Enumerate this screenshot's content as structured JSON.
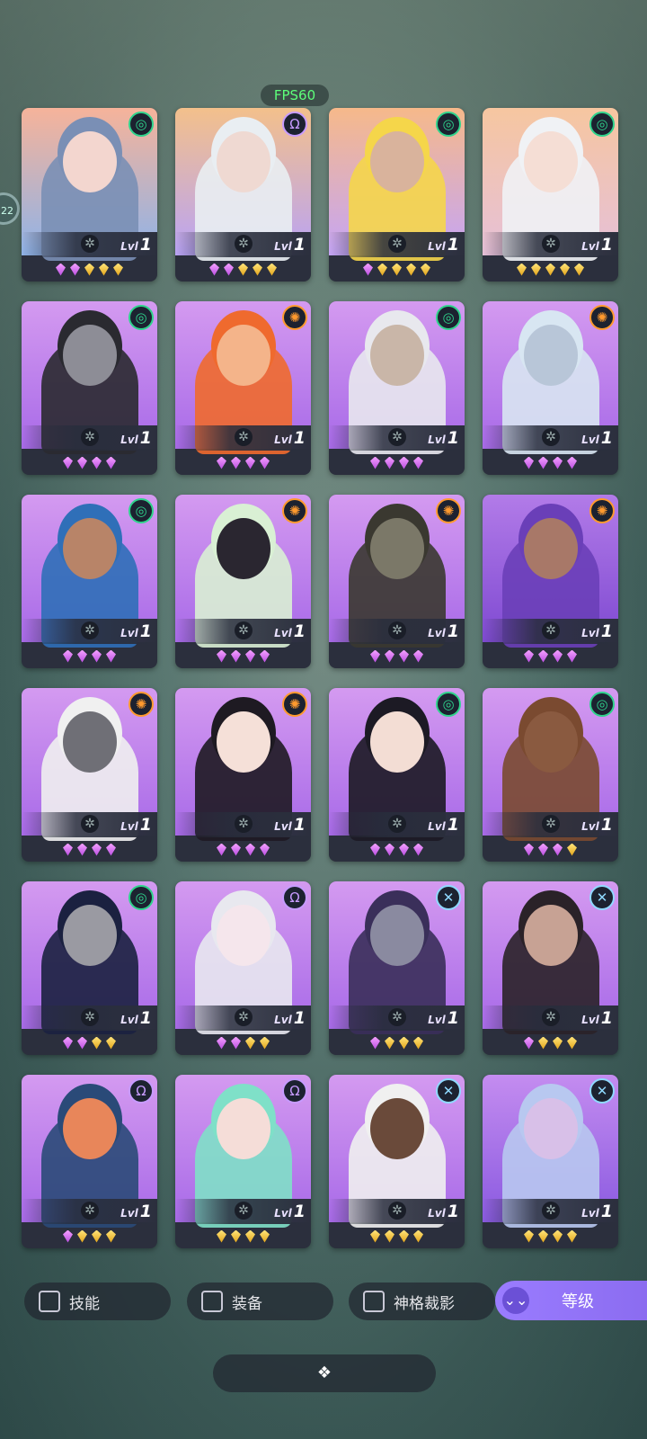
{
  "overlay": {
    "fps": "FPS60",
    "side_badge": "22"
  },
  "class_icons": {
    "swirl": {
      "glyph": "◎",
      "color": "#2fd38c"
    },
    "helm": {
      "glyph": "Ω",
      "color": "#c79bff"
    },
    "sun": {
      "glyph": "✺",
      "color": "#ff9a2e"
    },
    "cross": {
      "glyph": "✕",
      "color": "#8fd9ff"
    }
  },
  "lvl_prefix": "Lvl",
  "heroes": [
    {
      "level": "1",
      "cls": "swirl",
      "bg": [
        "#f6b39a",
        "#8fb3e8"
      ],
      "hair": "#7a8fb5",
      "skin": "#f3d6cf",
      "gems": "ppggg"
    },
    {
      "level": "1",
      "cls": "helm",
      "bg": [
        "#f3c08b",
        "#b9a3f5"
      ],
      "hair": "#e9eef2",
      "skin": "#efd9d2",
      "gems": "ppggg"
    },
    {
      "level": "1",
      "cls": "swirl",
      "bg": [
        "#f6b98a",
        "#c5a5f6"
      ],
      "hair": "#f5d64a",
      "skin": "#d9b39c",
      "gems": "pgggg"
    },
    {
      "level": "1",
      "cls": "swirl",
      "bg": [
        "#f6c6a0",
        "#e6c0d8"
      ],
      "hair": "#f0f2f5",
      "skin": "#f5ded5",
      "gems": "ggggg"
    },
    {
      "level": "1",
      "cls": "swirl",
      "bg": [
        "#d49af0",
        "#a86ae8"
      ],
      "hair": "#2a2a30",
      "skin": "#8d8d96",
      "gems": "pppp"
    },
    {
      "level": "1",
      "cls": "sun",
      "bg": [
        "#d49af0",
        "#a86ae8"
      ],
      "hair": "#ef6a2e",
      "skin": "#f4b48a",
      "gems": "pppp"
    },
    {
      "level": "1",
      "cls": "swirl",
      "bg": [
        "#d49af0",
        "#a86ae8"
      ],
      "hair": "#e8e8ee",
      "skin": "#c9b6a8",
      "gems": "pppp"
    },
    {
      "level": "1",
      "cls": "sun",
      "bg": [
        "#d49af0",
        "#a86ae8"
      ],
      "hair": "#d8e6f2",
      "skin": "#b8c6d8",
      "gems": "pppp"
    },
    {
      "level": "1",
      "cls": "swirl",
      "bg": [
        "#d49af0",
        "#a86ae8"
      ],
      "hair": "#2f6fb8",
      "skin": "#b88468",
      "gems": "pppp"
    },
    {
      "level": "1",
      "cls": "sun",
      "bg": [
        "#d49af0",
        "#a86ae8"
      ],
      "hair": "#d9f0d4",
      "skin": "#2a2630",
      "gems": "pppp"
    },
    {
      "level": "1",
      "cls": "sun",
      "bg": [
        "#d49af0",
        "#a86ae8"
      ],
      "hair": "#3a3830",
      "skin": "#7b7868",
      "gems": "pppp"
    },
    {
      "level": "1",
      "cls": "sun",
      "bg": [
        "#b27be8",
        "#7f4ad2"
      ],
      "hair": "#6a3fb8",
      "skin": "#a87868",
      "gems": "pppp"
    },
    {
      "level": "1",
      "cls": "sun",
      "bg": [
        "#d49af0",
        "#a86ae8"
      ],
      "hair": "#f0f0f0",
      "skin": "#6f6f76",
      "gems": "pppp"
    },
    {
      "level": "1",
      "cls": "sun",
      "bg": [
        "#d49af0",
        "#a86ae8"
      ],
      "hair": "#1e1a22",
      "skin": "#f5e0d8",
      "gems": "pppp"
    },
    {
      "level": "1",
      "cls": "swirl",
      "bg": [
        "#d49af0",
        "#a86ae8"
      ],
      "hair": "#1c1a24",
      "skin": "#f3ddd4",
      "gems": "pppp"
    },
    {
      "level": "1",
      "cls": "swirl",
      "bg": [
        "#d49af0",
        "#a86ae8"
      ],
      "hair": "#7a4a30",
      "skin": "#8a5a40",
      "gems": "pppg"
    },
    {
      "level": "1",
      "cls": "swirl",
      "bg": [
        "#d49af0",
        "#a86ae8"
      ],
      "hair": "#1b2140",
      "skin": "#9a9aa2",
      "gems": "ppgg"
    },
    {
      "level": "1",
      "cls": "helm",
      "bg": [
        "#d49af0",
        "#a86ae8"
      ],
      "hair": "#e8e8ef",
      "skin": "#f5e6ec",
      "gems": "ppgg"
    },
    {
      "level": "1",
      "cls": "cross",
      "bg": [
        "#d49af0",
        "#a86ae8"
      ],
      "hair": "#3a2f5a",
      "skin": "#8a8aa0",
      "gems": "pggg"
    },
    {
      "level": "1",
      "cls": "cross",
      "bg": [
        "#d49af0",
        "#a86ae8"
      ],
      "hair": "#2a2228",
      "skin": "#c7a294",
      "gems": "pggg"
    },
    {
      "level": "1",
      "cls": "helm",
      "bg": [
        "#d49af0",
        "#a86ae8"
      ],
      "hair": "#2a4a78",
      "skin": "#e8865a",
      "gems": "pggg"
    },
    {
      "level": "1",
      "cls": "helm",
      "bg": [
        "#d49af0",
        "#a86ae8"
      ],
      "hair": "#7fe0c8",
      "skin": "#f5ddd8",
      "gems": "gggg"
    },
    {
      "level": "1",
      "cls": "cross",
      "bg": [
        "#d49af0",
        "#a86ae8"
      ],
      "hair": "#f0f0f0",
      "skin": "#6a4a3a",
      "gems": "gggg"
    },
    {
      "level": "1",
      "cls": "cross",
      "bg": [
        "#c48cf0",
        "#8a5ae0"
      ],
      "hair": "#b8c8f0",
      "skin": "#d8c0e8",
      "gems": "gggg"
    }
  ],
  "filters": [
    {
      "label": "技能"
    },
    {
      "label": "装备"
    },
    {
      "label": "神格裁影"
    }
  ],
  "sort": {
    "label": "等级",
    "icon": "⌄⌄"
  },
  "bottom": {
    "icon": "❖"
  }
}
